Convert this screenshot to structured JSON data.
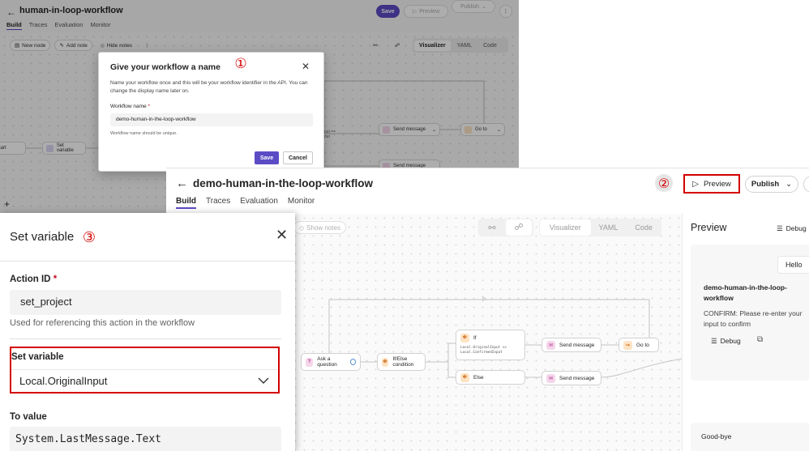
{
  "background_editor": {
    "title": "human-in-loop-workflow",
    "tabs": [
      "Build",
      "Traces",
      "Evaluation",
      "Monitor"
    ],
    "save_label": "Save",
    "preview_label": "Preview",
    "publish_label": "Publish",
    "toolbar": {
      "new_node": "New node",
      "add_note": "Add note",
      "hide_notes": "Hide notes"
    },
    "view_tabs": [
      "Visualizer",
      "YAML",
      "Code"
    ],
    "nodes": {
      "start": "tart",
      "set_variable": "Set variable",
      "send_message_1": "Send message",
      "goto": "Go to",
      "send_message_2": "Send message",
      "if_snippet": "input ==\ninput"
    }
  },
  "name_dialog": {
    "title": "Give your workflow a name",
    "description": "Name your workflow once and this will be your workflow identifier in the API. You can change the display name later on.",
    "field_label": "Workflow name",
    "required_mark": "*",
    "field_value": "demo-human-in-the-loop-workflow",
    "hint": "Workflow name should be unique.",
    "save_label": "Save",
    "cancel_label": "Cancel"
  },
  "annotations": [
    "①",
    "②",
    "③"
  ],
  "editor": {
    "title": "demo-human-in-the-loop-workflow",
    "tabs": [
      "Build",
      "Traces",
      "Evaluation",
      "Monitor"
    ],
    "preview_label": "Preview",
    "publish_label": "Publish",
    "show_notes": "Show notes",
    "view_tabs": [
      "Visualizer",
      "YAML",
      "Code"
    ],
    "nodes": {
      "ask_question": "Ask a question",
      "if_else": "If/Else condition",
      "if_label": "If",
      "if_condition": "Local.OriginalInput <>\nLocal.ConfirmedInput",
      "else_label": "Else",
      "send_message_1": "Send message",
      "send_message_2": "Send message",
      "goto": "Go to"
    }
  },
  "preview_pane": {
    "title": "Preview",
    "debug_label": "Debug",
    "user_message": "Hello",
    "bot_name": "demo-human-in-the-loop-workflow",
    "bot_message": "CONFIRM: Please re-enter your input to confirm",
    "msg_debug_label": "Debug",
    "footer_message": "Good-bye"
  },
  "set_variable_panel": {
    "title": "Set variable",
    "action_id_label": "Action ID",
    "required_mark": "*",
    "action_id_value": "set_project",
    "action_id_help": "Used for referencing this action in the workflow",
    "variable_label": "Set variable",
    "variable_value": "Local.OriginalInput",
    "to_value_label": "To value",
    "to_value_value": "System.LastMessage.Text"
  },
  "colors": {
    "accent": "#5b4bc4",
    "annotation_red": "#d40000",
    "tab_underline": "#5b4bc4"
  }
}
